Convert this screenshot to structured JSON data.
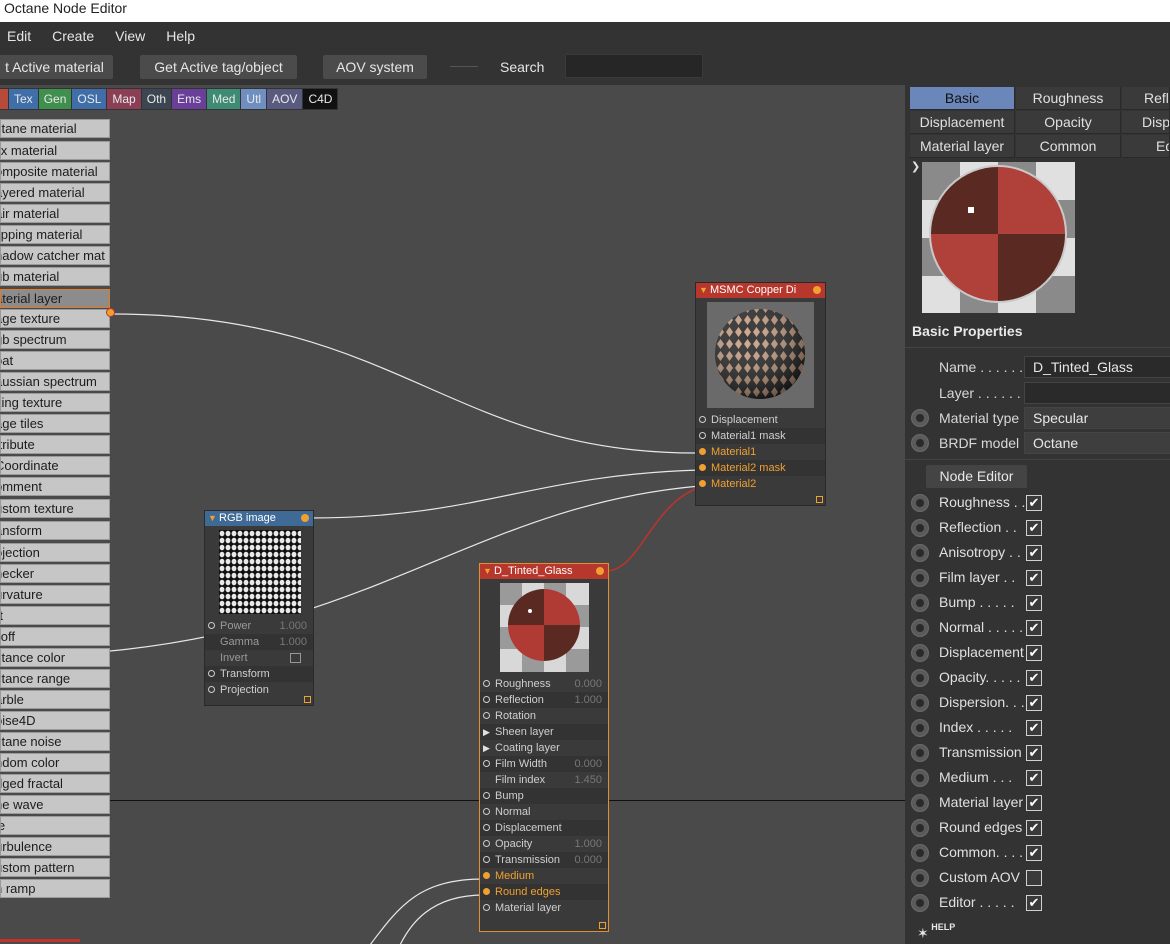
{
  "window": {
    "title": "Octane Node Editor"
  },
  "menu": [
    "Edit",
    "Create",
    "View",
    "Help"
  ],
  "toolbar": {
    "get_active_material": "t Active material",
    "get_active_tag": "Get Active tag/object",
    "aov_system": "AOV system",
    "search_label": "Search"
  },
  "categories": [
    {
      "label": "Tex",
      "color": "#3f6ea8"
    },
    {
      "label": "Gen",
      "color": "#3f8f4f"
    },
    {
      "label": "OSL",
      "color": "#3f6ea8"
    },
    {
      "label": "Map",
      "color": "#8a3f55"
    },
    {
      "label": "Oth",
      "color": "#3c4652"
    },
    {
      "label": "Ems",
      "color": "#6a3f9a"
    },
    {
      "label": "Med",
      "color": "#3f8a72"
    },
    {
      "label": "Utl",
      "color": "#6f8fc0"
    },
    {
      "label": "AOV",
      "color": "#5a5a80"
    },
    {
      "label": "C4D",
      "color": "#111111"
    }
  ],
  "node_list": [
    "ctane material",
    "lix material",
    "omposite material",
    "ayered material",
    "air material",
    "lipping material",
    "hadow catcher mat",
    "ub material",
    "aterial layer",
    "age texture",
    "gb spectrum",
    "oat",
    "aussian spectrum",
    "king texture",
    "age tiles",
    "ttribute",
    "Coordinate",
    "omment",
    "ustom texture",
    "ansform",
    "ojection",
    "hecker",
    "urvature",
    "rt",
    "lloff",
    "stance color",
    "stance range",
    "arble",
    "oise4D",
    "ctane noise",
    "ndom color",
    "dged fractal",
    "ne wave",
    "le",
    "urbulence",
    "ustom pattern",
    "n ramp"
  ],
  "nodes": {
    "msmc": {
      "title": "MSMC Copper Di",
      "inputs": [
        "Displacement",
        "Material1 mask",
        "Material1",
        "Material2 mask",
        "Material2"
      ]
    },
    "rgb": {
      "title": "RGB image",
      "params": [
        {
          "label": "Power",
          "value": "1.000"
        },
        {
          "label": "Gamma",
          "value": "1.000"
        },
        {
          "label": "Invert",
          "value": ""
        },
        {
          "label": "Transform",
          "value": ""
        },
        {
          "label": "Projection",
          "value": ""
        }
      ]
    },
    "glass": {
      "title": "D_Tinted_Glass",
      "params": [
        {
          "label": "Roughness",
          "value": "0.000"
        },
        {
          "label": "Reflection",
          "value": "1.000"
        },
        {
          "label": "Rotation",
          "value": ""
        },
        {
          "label": "Sheen layer",
          "value": ""
        },
        {
          "label": "Coating layer",
          "value": ""
        },
        {
          "label": "Film Width",
          "value": "0.000"
        },
        {
          "label": "Film index",
          "value": "1.450"
        },
        {
          "label": "Bump",
          "value": ""
        },
        {
          "label": "Normal",
          "value": ""
        },
        {
          "label": "Displacement",
          "value": ""
        },
        {
          "label": "Opacity",
          "value": "1.000"
        },
        {
          "label": "Transmission",
          "value": "0.000"
        },
        {
          "label": "Medium",
          "value": ""
        },
        {
          "label": "Round edges",
          "value": ""
        },
        {
          "label": "Material layer",
          "value": ""
        }
      ]
    }
  },
  "panel": {
    "tabs": [
      "Basic",
      "Roughness",
      "Refle",
      "Displacement",
      "Opacity",
      "Dispe",
      "Material layer",
      "Common",
      "Ed"
    ],
    "section_title": "Basic Properties",
    "name_label": "Name . . . . . .",
    "name_value": "D_Tinted_Glass",
    "layer_label": "Layer . . . . . .",
    "material_type_label": "Material type",
    "material_type_value": "Specular",
    "brdf_label": "BRDF model",
    "brdf_value": "Octane",
    "node_editor_button": "Node Editor",
    "toggles": [
      {
        "label": "Roughness . .",
        "checked": true
      },
      {
        "label": "Reflection . .",
        "checked": true
      },
      {
        "label": "Anisotropy . .",
        "checked": true
      },
      {
        "label": "Film layer . .",
        "checked": true
      },
      {
        "label": "Bump . . . . .",
        "checked": true
      },
      {
        "label": "Normal . . . . .",
        "checked": true
      },
      {
        "label": "Displacement",
        "checked": true
      },
      {
        "label": "Opacity. . . . .",
        "checked": true
      },
      {
        "label": "Dispersion. . .",
        "checked": true
      },
      {
        "label": "Index . . . . .",
        "checked": true
      },
      {
        "label": "Transmission",
        "checked": true
      },
      {
        "label": "Medium . . .",
        "checked": true
      },
      {
        "label": "Material layer",
        "checked": true
      },
      {
        "label": "Round edges",
        "checked": true
      },
      {
        "label": "Common. . . .",
        "checked": true
      },
      {
        "label": "Custom AOV",
        "checked": false
      },
      {
        "label": "Editor . . . . .",
        "checked": true
      }
    ],
    "help_label": "HELP"
  }
}
